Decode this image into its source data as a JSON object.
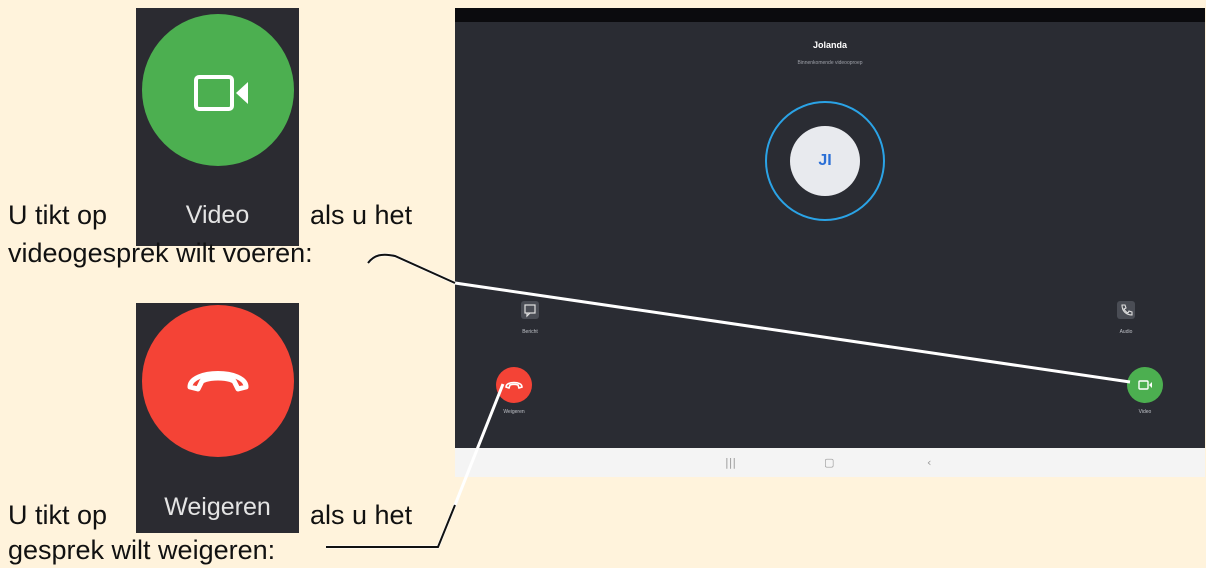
{
  "instruction_video": {
    "line1_prefix": "U tikt op",
    "line1_suffix": "als u het",
    "line2": "videogesprek wilt voeren:",
    "tile_label": "Video"
  },
  "instruction_decline": {
    "line1_prefix": "U tikt op",
    "line1_suffix": "als u het",
    "line2": "gesprek wilt weigeren:",
    "tile_label": "Weigeren"
  },
  "call_screen": {
    "caller_name": "Jolanda",
    "caller_subtitle": "Binnenkomende videooproep",
    "avatar_initials": "JI",
    "buttons": {
      "message_label": "Bericht",
      "audio_label": "Audio",
      "decline_label": "Weigeren",
      "video_label": "Video"
    },
    "nav": {
      "recent": "|||",
      "home": "▢",
      "back": "‹"
    }
  },
  "colors": {
    "background": "#fff3dc",
    "video_green": "#4caf50",
    "decline_red": "#f44336",
    "screen_dark": "#2a2c33",
    "ring_blue": "#2aa3e6"
  },
  "icons": {
    "video": "video-camera-icon",
    "decline": "phone-hangup-icon",
    "message": "message-icon",
    "audio": "phone-icon"
  }
}
